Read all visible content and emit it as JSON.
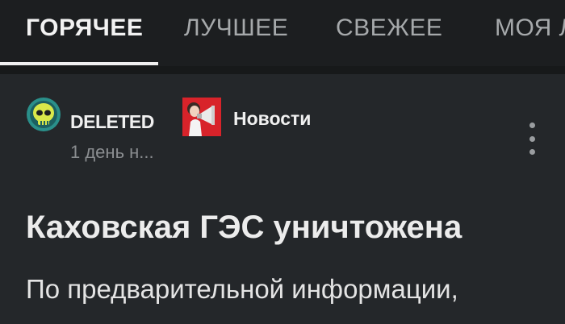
{
  "tabs": [
    {
      "label": "ГОРЯЧЕЕ",
      "active": true
    },
    {
      "label": "ЛУЧШЕЕ",
      "active": false
    },
    {
      "label": "СВЕЖЕЕ",
      "active": false
    },
    {
      "label": "МОЯ Л",
      "active": false
    }
  ],
  "post": {
    "author": "DELETED",
    "time": "1 день н...",
    "community": "Новости",
    "title": "Каховская ГЭС уничтожена",
    "body_first_line": "По предварительной информации,"
  },
  "icons": {
    "author_avatar": "skull-avatar-icon",
    "community": "megaphone-community-icon",
    "menu": "kebab-menu-icon"
  },
  "colors": {
    "background": "#24272a",
    "tabbar": "#1c1e20",
    "accent_red": "#d8232a",
    "avatar_yellow": "#d9e84a"
  }
}
